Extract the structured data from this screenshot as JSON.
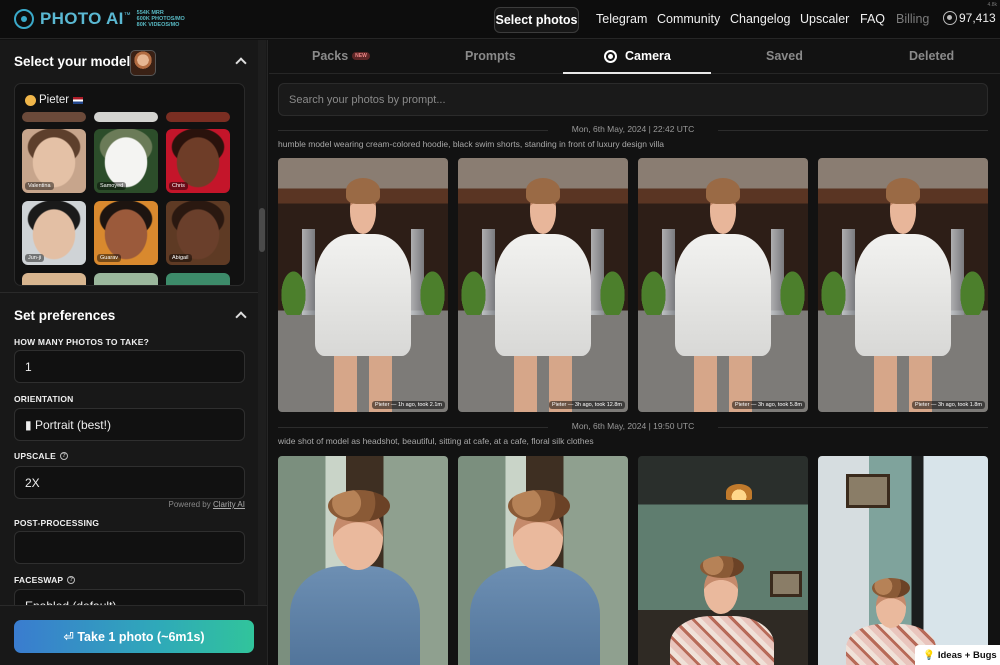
{
  "app": {
    "logo_text": "PHOTO AI",
    "logo_tm": "™",
    "stats": [
      "554K MRR",
      "600K PHOTOS/MO",
      "80K VIDEOS/MO"
    ],
    "version": "4.8k"
  },
  "nav": {
    "select_photos": "Select photos",
    "telegram": "Telegram",
    "community": "Community",
    "changelog": "Changelog",
    "upscaler": "Upscaler",
    "faq": "FAQ",
    "billing": "Billing",
    "credits": "97,413"
  },
  "sidebar": {
    "model_section_title": "Select your model",
    "selected_model": "Pieter",
    "models": [
      {
        "name": "Valentina",
        "colors": [
          "#c7a58c",
          "#e4c1a6",
          "#5d3f2c"
        ]
      },
      {
        "name": "Samoyed",
        "colors": [
          "#2c4d2a",
          "#f4f4f2",
          "#6b7b58"
        ]
      },
      {
        "name": "Chris",
        "colors": [
          "#c4152a",
          "#6e3d28",
          "#2a120c"
        ]
      },
      {
        "name": "Jun-ji",
        "colors": [
          "#cfd3d6",
          "#e3bfa4",
          "#1a1a1a"
        ]
      },
      {
        "name": "Guarav",
        "colors": [
          "#d9892e",
          "#9b5a3b",
          "#1d1410"
        ]
      },
      {
        "name": "Abigail",
        "colors": [
          "#5e3a24",
          "#6a3f2b",
          "#2a1810"
        ]
      }
    ],
    "preferences_title": "Set preferences",
    "photos_label": "HOW MANY PHOTOS TO TAKE?",
    "photos_value": "1",
    "orientation_label": "ORIENTATION",
    "orientation_value": "▮ Portrait (best!)",
    "upscale_label": "UPSCALE",
    "upscale_value": "2X",
    "powered_by_prefix": "Powered by",
    "powered_by_link": "Clarity AI",
    "postprocessing_label": "POST-PROCESSING",
    "postprocessing_value": "",
    "faceswap_label": "FACESWAP",
    "faceswap_value": "Enabled (default)",
    "take_button": "⏎ Take 1 photo (~6m1s)"
  },
  "main": {
    "tabs": {
      "packs": "Packs",
      "packs_badge": "NEW",
      "prompts": "Prompts",
      "camera": "Camera",
      "saved": "Saved",
      "deleted": "Deleted"
    },
    "search_placeholder": "Search your photos by prompt...",
    "groups": [
      {
        "date": "Mon, 6th May, 2024 | 22:42 UTC",
        "prompt": "humble model wearing cream-colored hoodie, black swim shorts, standing in front of luxury design villa",
        "photos": [
          {
            "meta": "Pieter — 1h ago, took 2.1m"
          },
          {
            "meta": "Pieter — 3h ago, took 12.8m"
          },
          {
            "meta": "Pieter — 3h ago, took 5.8m"
          },
          {
            "meta": "Pieter — 3h ago, took 1.8m"
          }
        ]
      },
      {
        "date": "Mon, 6th May, 2024 | 19:50 UTC",
        "prompt": "wide shot of model as headshot, beautiful, sitting at cafe, at a cafe, floral silk clothes"
      }
    ]
  },
  "widget": {
    "ideas_bugs": "Ideas + Bugs"
  }
}
